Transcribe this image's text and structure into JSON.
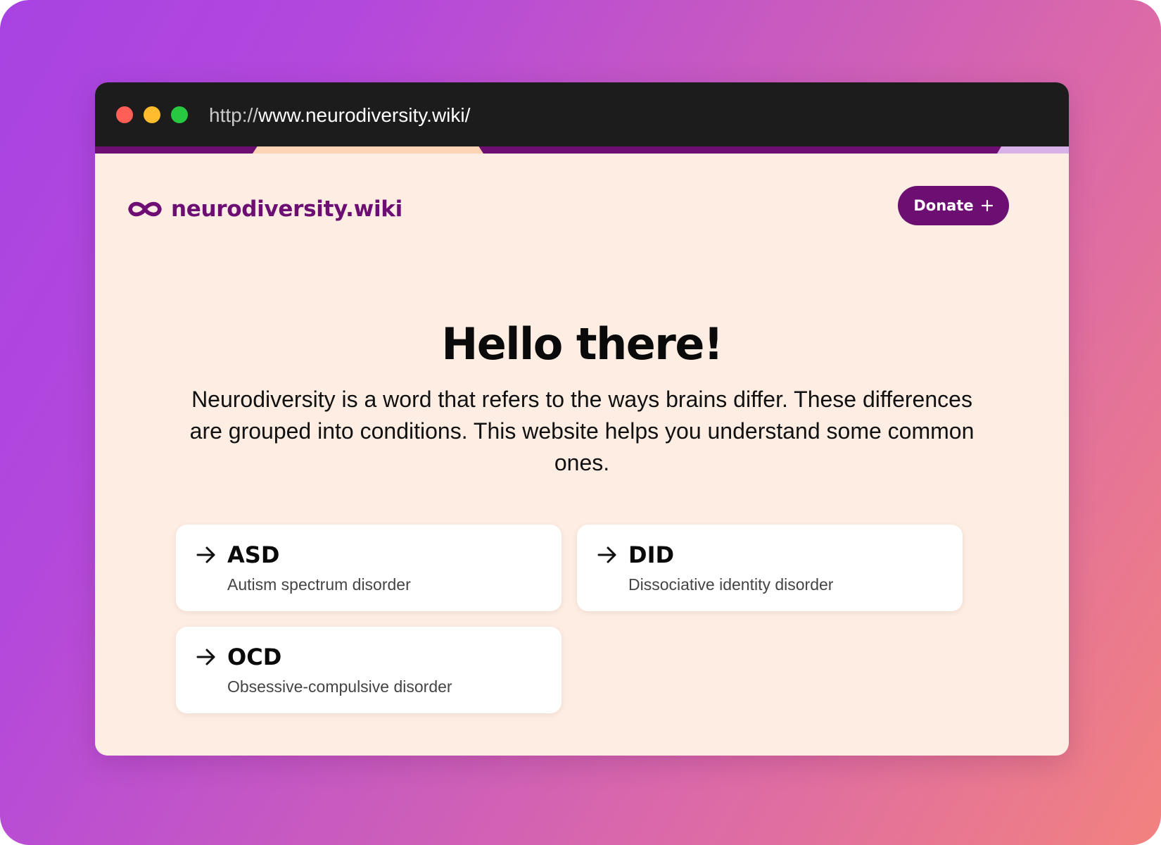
{
  "browser": {
    "url_scheme": "http://",
    "url_rest": "www.neurodiversity.wiki/"
  },
  "header": {
    "logo_text": "neurodiversity.wiki",
    "logo_icon": "infinity-icon",
    "donate_label": "Donate",
    "donate_icon": "plus-icon"
  },
  "hero": {
    "title": "Hello there!",
    "text": "Neurodiversity is a word that refers to the ways brains differ. These differences are grouped into conditions. This website helps you understand some common ones."
  },
  "conditions": [
    {
      "abbr": "ASD",
      "name": "Autism spectrum disorder",
      "icon": "arrow-right-icon"
    },
    {
      "abbr": "DID",
      "name": "Dissociative identity disorder",
      "icon": "arrow-right-icon"
    },
    {
      "abbr": "OCD",
      "name": "Obsessive-compulsive disorder",
      "icon": "arrow-right-icon"
    }
  ],
  "colors": {
    "brand": "#6d0e73",
    "page_background": "#fdede3",
    "titlebar": "#1c1c1c",
    "backdrop_start": "#a843e2",
    "backdrop_end": "#f2827f"
  }
}
